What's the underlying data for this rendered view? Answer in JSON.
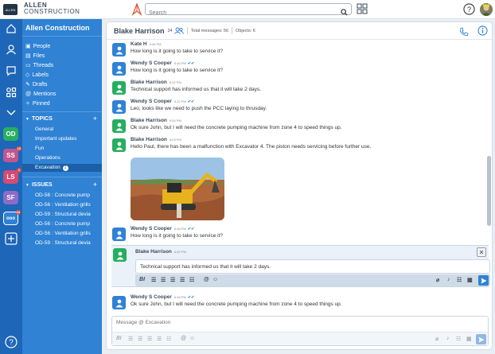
{
  "app": {
    "logo_text": "ALLEN",
    "brand_line1": "ALLEN",
    "brand_line2": "CONSTRUCTION"
  },
  "search": {
    "placeholder": "Search",
    "value": ""
  },
  "rail": {
    "badges": [
      {
        "label": "OD",
        "color": "#27ae60",
        "count": ""
      },
      {
        "label": "SS",
        "color": "#c0568f",
        "count": "13"
      },
      {
        "label": "LS",
        "color": "#d64a74",
        "count": "1"
      },
      {
        "label": "SF",
        "color": "#8e6bc7",
        "count": ""
      },
      {
        "label": "ooo",
        "color": "#2f82d4",
        "count": "34"
      }
    ]
  },
  "sidebar": {
    "title": "Allen Construction",
    "nav": [
      {
        "label": "People",
        "icon": "people-icon"
      },
      {
        "label": "Files",
        "icon": "files-icon"
      },
      {
        "label": "Threads",
        "icon": "threads-icon"
      },
      {
        "label": "Labels",
        "icon": "labels-icon"
      },
      {
        "label": "Drafts",
        "icon": "drafts-icon"
      },
      {
        "label": "Mentions",
        "icon": "mentions-icon"
      },
      {
        "label": "Pinned",
        "icon": "pinned-icon"
      }
    ],
    "topics_header": "TOPICS",
    "topics": [
      "General",
      "Important updates",
      "Fun",
      "Operations",
      "Excavation"
    ],
    "active_topic_badge": "2",
    "issues_header": "ISSUES",
    "issues": [
      "OD-56 : Concrete pump",
      "OD-56 : Ventilation grills",
      "OD-59 : Structural devia",
      "OD-56 : Concrete pump",
      "OD-56 : Ventilation grills",
      "OD-59 : Structural devia"
    ]
  },
  "channel": {
    "name": "Blake Harrison",
    "member_count": "34",
    "total_messages": "Total messages: 56",
    "objects": "Objects: 6"
  },
  "messages": [
    {
      "author": "Kate H",
      "time": "6:46 PM",
      "text": "How long is it going to take to service it?",
      "avatar_color": "#2f82d4",
      "read": false
    },
    {
      "author": "Wendy S Cooper",
      "time": "6:46 PM",
      "text": "How long is it going to take to service it?",
      "avatar_color": "#2f82d4",
      "read": true
    },
    {
      "author": "Blake Harrison",
      "time": "6:52 PM",
      "text": "Technical support has informed us that it will take 2 days.",
      "avatar_color": "#27ae60",
      "read": false
    },
    {
      "author": "Wendy S Cooper",
      "time": "9:22 PM",
      "text": "Leo, looks like we need to push the PCC laying to thrusday.",
      "avatar_color": "#2f82d4",
      "read": true
    },
    {
      "author": "Blake Harrison",
      "time": "9:34 PM",
      "text": "Ok sure John, but I will need the concrete pumping machine from zone 4 to speed things up.",
      "avatar_color": "#27ae60",
      "read": false
    },
    {
      "author": "Blake Harrison",
      "time": "8:03 PM",
      "text": "Hello Paul, there has been a malfunction with Excavator 4. The piston needs servicing before further use.",
      "avatar_color": "#27ae60",
      "read": false
    },
    {
      "author": "Wendy S Cooper",
      "time": "6:46 PM",
      "text": "How long is it going to take to service it?",
      "avatar_color": "#2f82d4",
      "read": true
    },
    {
      "author": "Wendy S Cooper",
      "time": "6:46 PM",
      "text": "Ok sure John, but I will need the concrete pumping machine from zone 4 to speed things up.",
      "avatar_color": "#2f82d4",
      "read": true
    }
  ],
  "editing": {
    "author": "Blake Harrison",
    "time": "6:52 PM",
    "text": "Technical support has informed us that it will take 2 days."
  },
  "composer": {
    "placeholder": "Message @ Excavation"
  }
}
